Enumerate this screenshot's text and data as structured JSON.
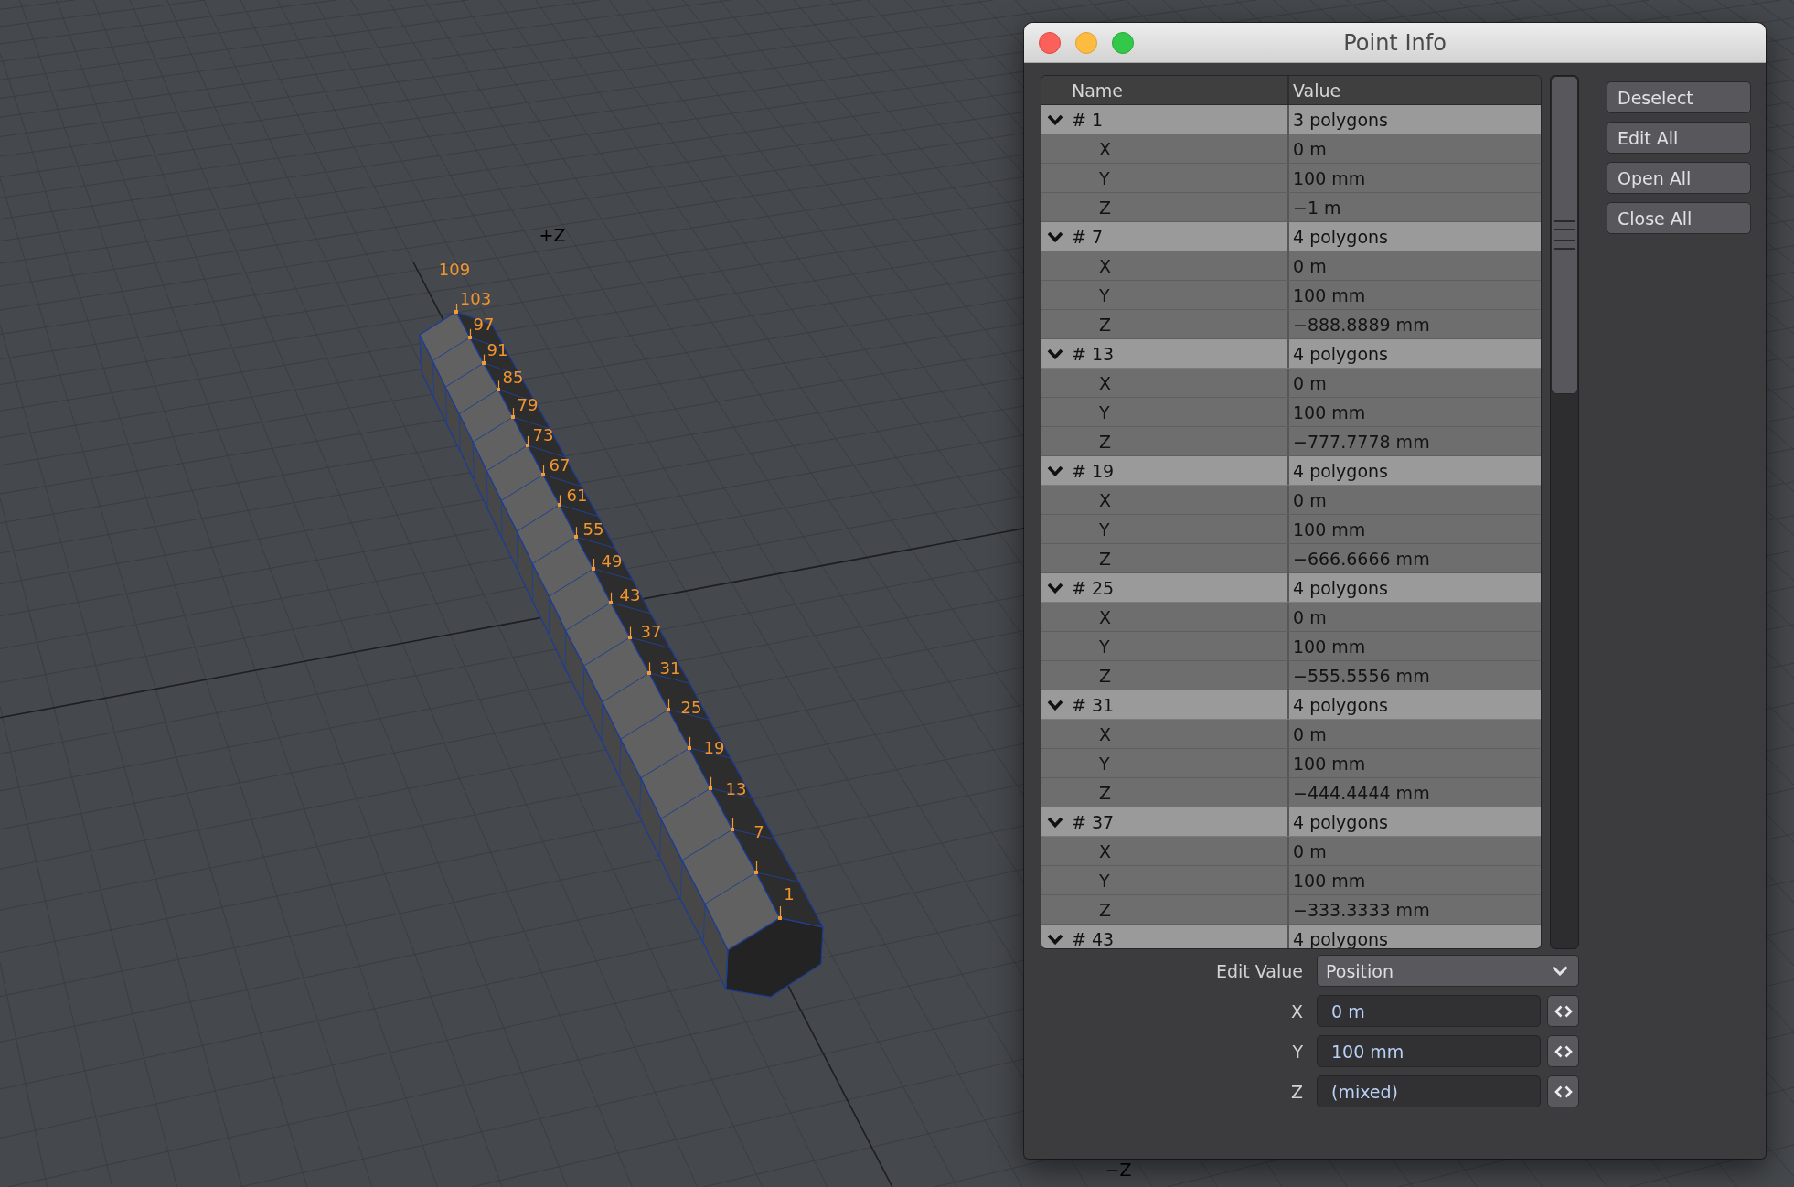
{
  "viewport": {
    "axis_labels": [
      "+Z",
      "−Z"
    ],
    "point_labels": [
      "109",
      "103",
      "97",
      "91",
      "85",
      "79",
      "73",
      "67",
      "61",
      "55",
      "49",
      "43",
      "37",
      "31",
      "25",
      "19",
      "13",
      "7",
      "1"
    ]
  },
  "window": {
    "title": "Point Info"
  },
  "table": {
    "columns": [
      "Name",
      "Value"
    ],
    "rows": [
      {
        "name": "# 1",
        "value": "3 polygons",
        "expanded": true,
        "children": [
          {
            "name": "X",
            "value": "0 m"
          },
          {
            "name": "Y",
            "value": "100 mm"
          },
          {
            "name": "Z",
            "value": "−1 m"
          }
        ]
      },
      {
        "name": "# 7",
        "value": "4 polygons",
        "expanded": true,
        "children": [
          {
            "name": "X",
            "value": "0 m"
          },
          {
            "name": "Y",
            "value": "100 mm"
          },
          {
            "name": "Z",
            "value": "−888.8889 mm"
          }
        ]
      },
      {
        "name": "# 13",
        "value": "4 polygons",
        "expanded": true,
        "children": [
          {
            "name": "X",
            "value": "0 m"
          },
          {
            "name": "Y",
            "value": "100 mm"
          },
          {
            "name": "Z",
            "value": "−777.7778 mm"
          }
        ]
      },
      {
        "name": "# 19",
        "value": "4 polygons",
        "expanded": true,
        "children": [
          {
            "name": "X",
            "value": "0 m"
          },
          {
            "name": "Y",
            "value": "100 mm"
          },
          {
            "name": "Z",
            "value": "−666.6666 mm"
          }
        ]
      },
      {
        "name": "# 25",
        "value": "4 polygons",
        "expanded": true,
        "children": [
          {
            "name": "X",
            "value": "0 m"
          },
          {
            "name": "Y",
            "value": "100 mm"
          },
          {
            "name": "Z",
            "value": "−555.5556 mm"
          }
        ]
      },
      {
        "name": "# 31",
        "value": "4 polygons",
        "expanded": true,
        "children": [
          {
            "name": "X",
            "value": "0 m"
          },
          {
            "name": "Y",
            "value": "100 mm"
          },
          {
            "name": "Z",
            "value": "−444.4444 mm"
          }
        ]
      },
      {
        "name": "# 37",
        "value": "4 polygons",
        "expanded": true,
        "children": [
          {
            "name": "X",
            "value": "0 m"
          },
          {
            "name": "Y",
            "value": "100 mm"
          },
          {
            "name": "Z",
            "value": "−333.3333 mm"
          }
        ]
      },
      {
        "name": "# 43",
        "value": "4 polygons",
        "expanded": true
      }
    ]
  },
  "buttons": [
    "Deselect",
    "Edit All",
    "Open All",
    "Close All"
  ],
  "edit_value": {
    "label": "Edit Value",
    "mode": "Position",
    "fields": [
      {
        "label": "X",
        "value": "0 m"
      },
      {
        "label": "Y",
        "value": "100 mm"
      },
      {
        "label": "Z",
        "value": "(mixed)"
      }
    ]
  }
}
